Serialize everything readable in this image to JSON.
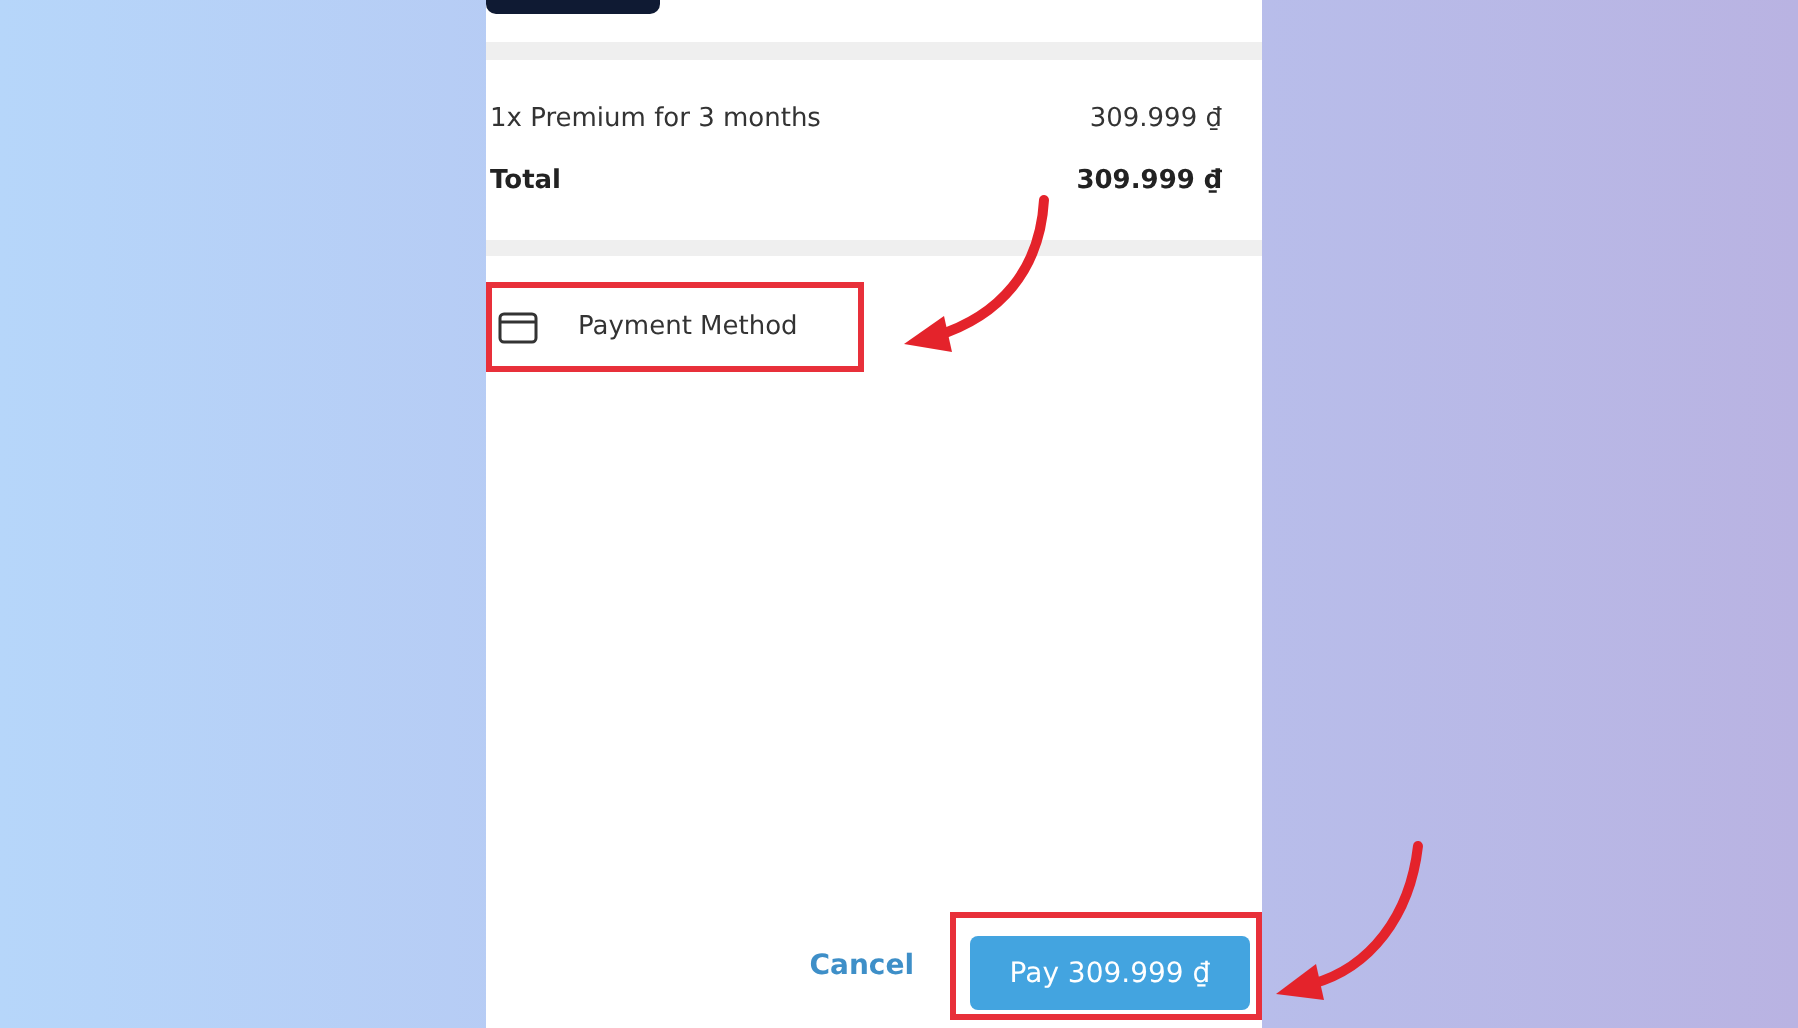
{
  "order": {
    "items": [
      {
        "name": "1x Premium for 3 months",
        "price": "309.999 ₫"
      }
    ],
    "total": {
      "label": "Total",
      "amount": "309.999 ₫"
    }
  },
  "payment_method": {
    "label": "Payment Method",
    "highlighted": true
  },
  "actions": {
    "cancel": "Cancel",
    "pay": "Pay 309.999 ₫",
    "pay_highlighted": true
  }
}
